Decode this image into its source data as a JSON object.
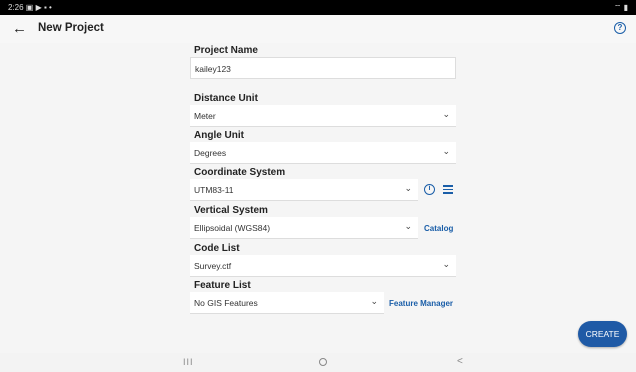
{
  "status_bar": {
    "time_and_icons": "2:26 ▣ ▶ ▪ •",
    "right_icons": "⌔ ▮"
  },
  "app_bar": {
    "back_icon": "←",
    "title": "New Project",
    "help_icon": "?"
  },
  "form": {
    "project_name": {
      "label": "Project Name",
      "value": "kailey123"
    },
    "distance_unit": {
      "label": "Distance Unit",
      "value": "Meter"
    },
    "angle_unit": {
      "label": "Angle Unit",
      "value": "Degrees"
    },
    "coordinate_system": {
      "label": "Coordinate System",
      "value": "UTM83-11",
      "info_icon": "i"
    },
    "vertical_system": {
      "label": "Vertical System",
      "value": "Ellipsoidal (WGS84)",
      "catalog_link": "Catalog"
    },
    "code_list": {
      "label": "Code List",
      "value": "Survey.ctf"
    },
    "feature_list": {
      "label": "Feature List",
      "value": "No GIS Features",
      "manager_link": "Feature Manager"
    },
    "chevron_icon": "⌄"
  },
  "create_button": {
    "label": "CREATE"
  },
  "nav_bar": {
    "recents": "III",
    "back": "<"
  },
  "colors": {
    "accent": "#1a5ea8",
    "button": "#1f5aa6",
    "status_bar": "#000000"
  }
}
